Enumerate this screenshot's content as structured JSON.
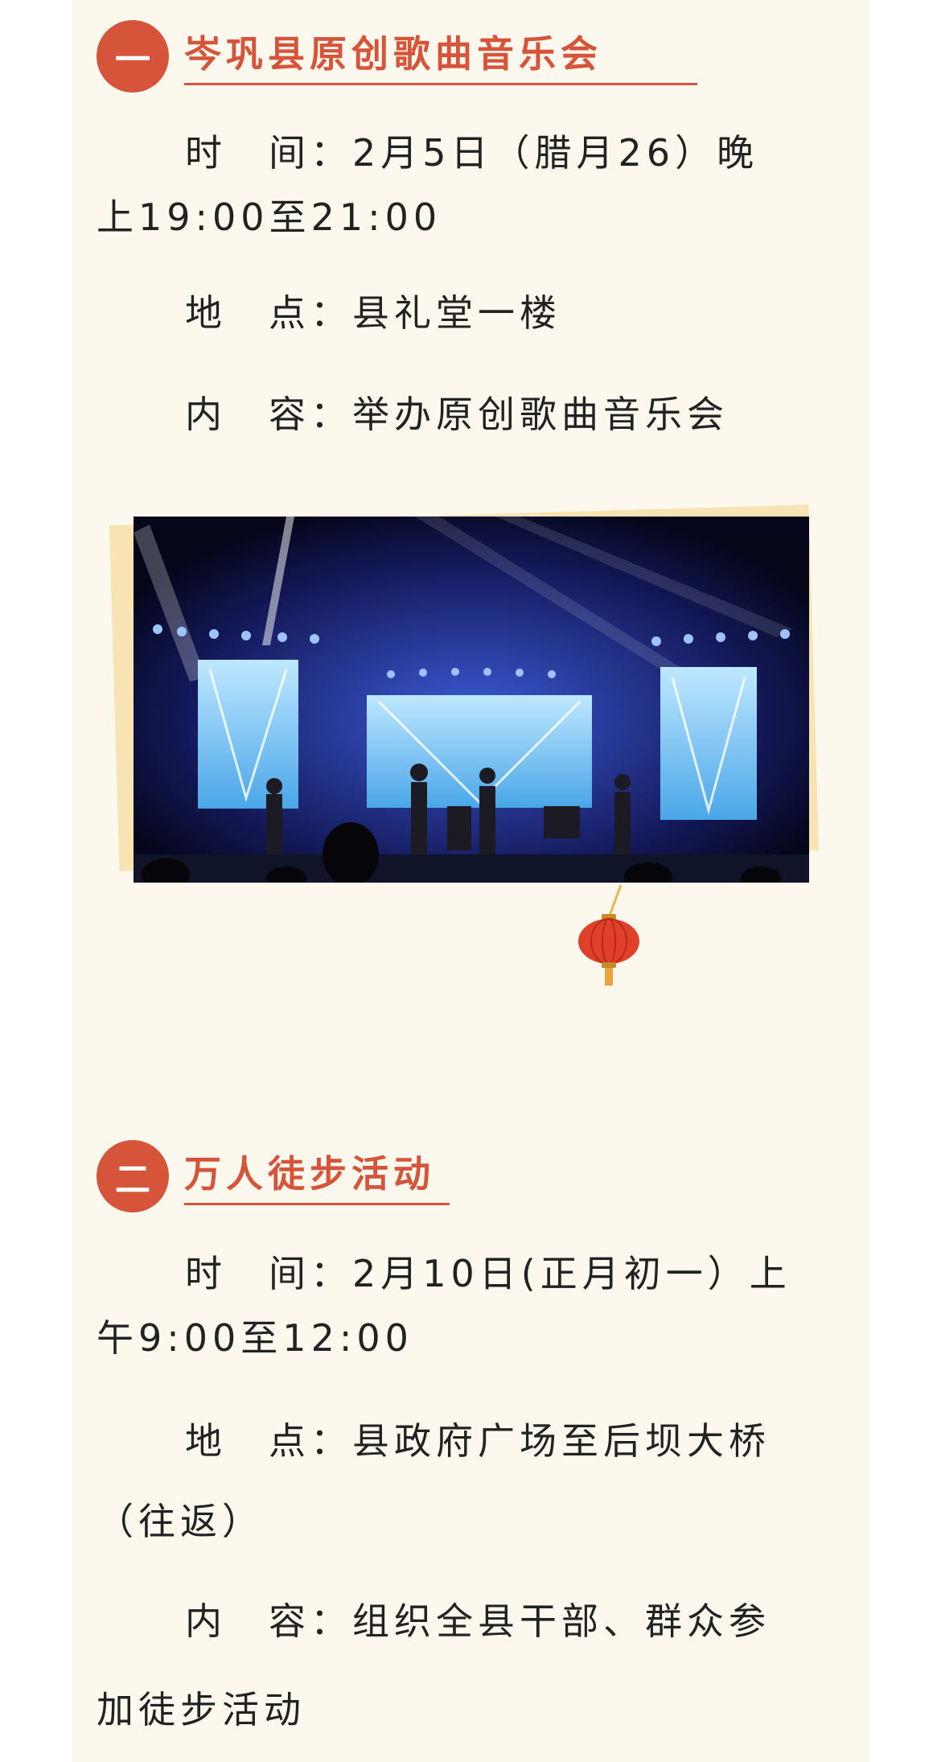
{
  "sections": [
    {
      "number": "一",
      "title": "岑巩县原创歌曲音乐会",
      "time_line1": "时　间：2月5日（腊月26）晚",
      "time_line2": "上19:00至21:00",
      "place_line": "地　点：县礼堂一楼",
      "content_line": "内　容：举办原创歌曲音乐会"
    },
    {
      "number": "二",
      "title": "万人徒步活动",
      "time_line1": "时　间：2月10日(正月初一）上",
      "time_line2": "午9:00至12:00",
      "place_line1": "地　点：县政府广场至后坝大桥",
      "place_line2": "（往返）",
      "content_line1": "内　容：组织全县干部、群众参",
      "content_line2": "加徒步活动"
    }
  ],
  "colors": {
    "accent": "#d6553a",
    "card_bg": "#fdf8ee",
    "text": "#222222"
  },
  "decor": {
    "photo": "concert-stage-photo",
    "lantern": "red-lantern-icon"
  }
}
